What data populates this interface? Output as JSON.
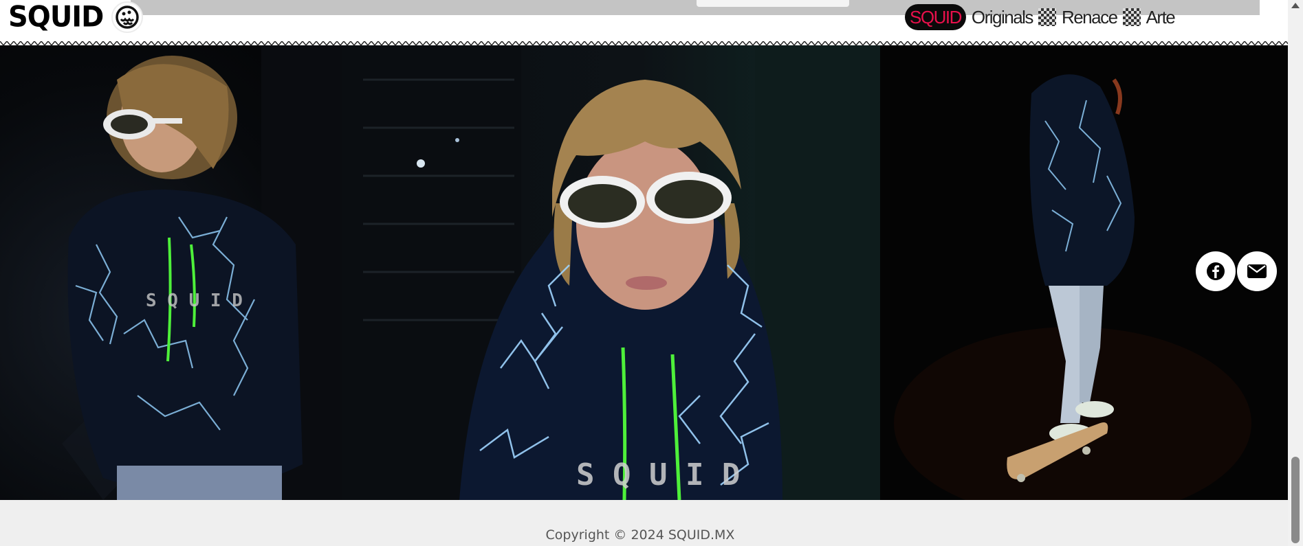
{
  "brand": {
    "logo_text": "SQUID"
  },
  "nav": {
    "items": [
      {
        "label": "SQUID",
        "active": true
      },
      {
        "label": "Originals"
      },
      {
        "label": "Renace"
      },
      {
        "label": "Arte"
      }
    ]
  },
  "social": {
    "buttons": [
      {
        "icon": "facebook-icon"
      },
      {
        "icon": "mail-icon"
      }
    ]
  },
  "footer": {
    "copyright": "Copyright © 2024 SQUID.MX"
  },
  "colors": {
    "accent": "#e8104b",
    "pill_bg": "#0a0a0a",
    "footer_bg": "#efefef",
    "lightning": "#7cc4ff",
    "drawstring": "#4ef03a"
  }
}
